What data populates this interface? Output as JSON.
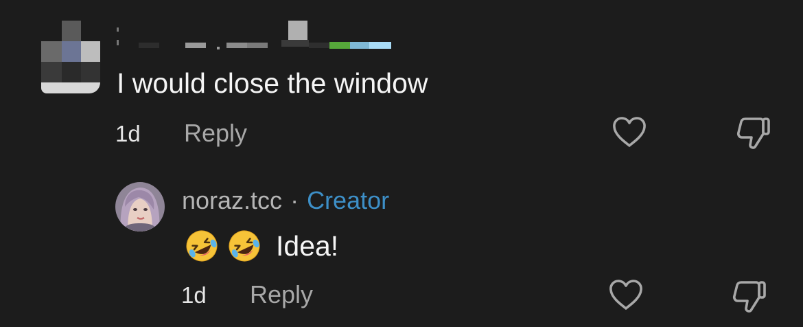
{
  "comment": {
    "text": "I would close the window",
    "time": "1d",
    "reply_label": "Reply",
    "like_icon": "heart-icon",
    "dislike_icon": "thumbs-down-icon"
  },
  "reply": {
    "username": "noraz.tcc",
    "separator": "·",
    "badge": "Creator",
    "emojis": [
      "rolling-on-floor-laughing-emoji",
      "rolling-on-floor-laughing-emoji"
    ],
    "text": "Idea!",
    "time": "1d",
    "reply_label": "Reply",
    "like_icon": "heart-icon",
    "dislike_icon": "thumbs-down-icon"
  },
  "colors": {
    "background": "#1c1c1c",
    "creator_badge": "#3d8fc7",
    "secondary_text": "#a8a8a8"
  }
}
